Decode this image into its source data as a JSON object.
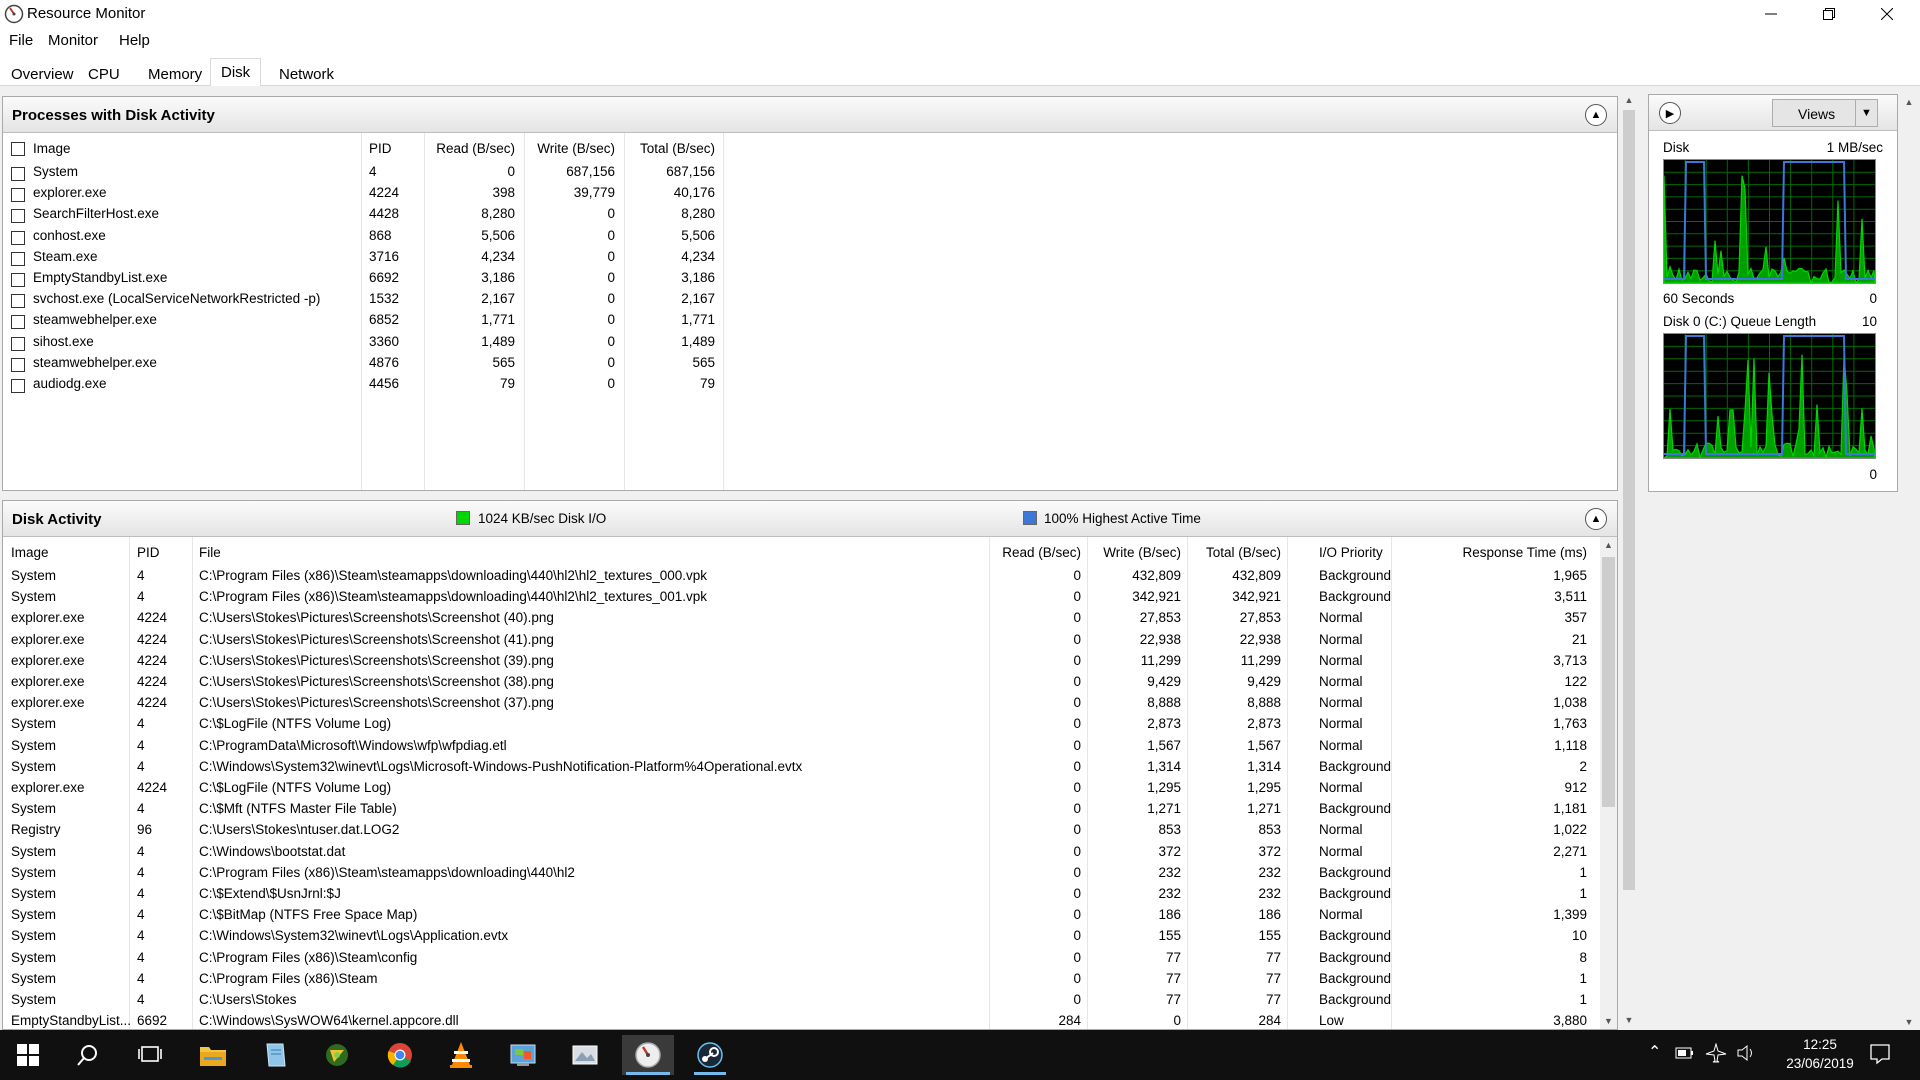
{
  "window": {
    "title": "Resource Monitor",
    "icon": "resource-monitor-icon"
  },
  "menu": [
    "File",
    "Monitor",
    "Help"
  ],
  "tabs": [
    "Overview",
    "CPU",
    "Memory",
    "Disk",
    "Network"
  ],
  "active_tab": "Disk",
  "processes": {
    "title": "Processes with Disk Activity",
    "headers": [
      "Image",
      "PID",
      "Read (B/sec)",
      "Write (B/sec)",
      "Total (B/sec)"
    ],
    "rows": [
      [
        "System",
        "4",
        "0",
        "687,156",
        "687,156"
      ],
      [
        "explorer.exe",
        "4224",
        "398",
        "39,779",
        "40,176"
      ],
      [
        "SearchFilterHost.exe",
        "4428",
        "8,280",
        "0",
        "8,280"
      ],
      [
        "conhost.exe",
        "868",
        "5,506",
        "0",
        "5,506"
      ],
      [
        "Steam.exe",
        "3716",
        "4,234",
        "0",
        "4,234"
      ],
      [
        "EmptyStandbyList.exe",
        "6692",
        "3,186",
        "0",
        "3,186"
      ],
      [
        "svchost.exe (LocalServiceNetworkRestricted -p)",
        "1532",
        "2,167",
        "0",
        "2,167"
      ],
      [
        "steamwebhelper.exe",
        "6852",
        "1,771",
        "0",
        "1,771"
      ],
      [
        "sihost.exe",
        "3360",
        "1,489",
        "0",
        "1,489"
      ],
      [
        "steamwebhelper.exe",
        "4876",
        "565",
        "0",
        "565"
      ],
      [
        "audiodg.exe",
        "4456",
        "79",
        "0",
        "79"
      ]
    ]
  },
  "disk_activity": {
    "title": "Disk Activity",
    "legend_io": "1024 KB/sec Disk I/O",
    "legend_active": "100% Highest Active Time",
    "headers": [
      "Image",
      "PID",
      "File",
      "Read (B/sec)",
      "Write (B/sec)",
      "Total (B/sec)",
      "I/O Priority",
      "Response Time (ms)"
    ],
    "rows": [
      [
        "System",
        "4",
        "C:\\Program Files (x86)\\Steam\\steamapps\\downloading\\440\\hl2\\hl2_textures_000.vpk",
        "0",
        "432,809",
        "432,809",
        "Background",
        "1,965"
      ],
      [
        "System",
        "4",
        "C:\\Program Files (x86)\\Steam\\steamapps\\downloading\\440\\hl2\\hl2_textures_001.vpk",
        "0",
        "342,921",
        "342,921",
        "Background",
        "3,511"
      ],
      [
        "explorer.exe",
        "4224",
        "C:\\Users\\Stokes\\Pictures\\Screenshots\\Screenshot (40).png",
        "0",
        "27,853",
        "27,853",
        "Normal",
        "357"
      ],
      [
        "explorer.exe",
        "4224",
        "C:\\Users\\Stokes\\Pictures\\Screenshots\\Screenshot (41).png",
        "0",
        "22,938",
        "22,938",
        "Normal",
        "21"
      ],
      [
        "explorer.exe",
        "4224",
        "C:\\Users\\Stokes\\Pictures\\Screenshots\\Screenshot (39).png",
        "0",
        "11,299",
        "11,299",
        "Normal",
        "3,713"
      ],
      [
        "explorer.exe",
        "4224",
        "C:\\Users\\Stokes\\Pictures\\Screenshots\\Screenshot (38).png",
        "0",
        "9,429",
        "9,429",
        "Normal",
        "122"
      ],
      [
        "explorer.exe",
        "4224",
        "C:\\Users\\Stokes\\Pictures\\Screenshots\\Screenshot (37).png",
        "0",
        "8,888",
        "8,888",
        "Normal",
        "1,038"
      ],
      [
        "System",
        "4",
        "C:\\$LogFile (NTFS Volume Log)",
        "0",
        "2,873",
        "2,873",
        "Normal",
        "1,763"
      ],
      [
        "System",
        "4",
        "C:\\ProgramData\\Microsoft\\Windows\\wfp\\wfpdiag.etl",
        "0",
        "1,567",
        "1,567",
        "Normal",
        "1,118"
      ],
      [
        "System",
        "4",
        "C:\\Windows\\System32\\winevt\\Logs\\Microsoft-Windows-PushNotification-Platform%4Operational.evtx",
        "0",
        "1,314",
        "1,314",
        "Background",
        "2"
      ],
      [
        "explorer.exe",
        "4224",
        "C:\\$LogFile (NTFS Volume Log)",
        "0",
        "1,295",
        "1,295",
        "Normal",
        "912"
      ],
      [
        "System",
        "4",
        "C:\\$Mft (NTFS Master File Table)",
        "0",
        "1,271",
        "1,271",
        "Background",
        "1,181"
      ],
      [
        "Registry",
        "96",
        "C:\\Users\\Stokes\\ntuser.dat.LOG2",
        "0",
        "853",
        "853",
        "Normal",
        "1,022"
      ],
      [
        "System",
        "4",
        "C:\\Windows\\bootstat.dat",
        "0",
        "372",
        "372",
        "Normal",
        "2,271"
      ],
      [
        "System",
        "4",
        "C:\\Program Files (x86)\\Steam\\steamapps\\downloading\\440\\hl2",
        "0",
        "232",
        "232",
        "Background",
        "1"
      ],
      [
        "System",
        "4",
        "C:\\$Extend\\$UsnJrnl:$J",
        "0",
        "232",
        "232",
        "Background",
        "1"
      ],
      [
        "System",
        "4",
        "C:\\$BitMap (NTFS Free Space Map)",
        "0",
        "186",
        "186",
        "Normal",
        "1,399"
      ],
      [
        "System",
        "4",
        "C:\\Windows\\System32\\winevt\\Logs\\Application.evtx",
        "0",
        "155",
        "155",
        "Background",
        "10"
      ],
      [
        "System",
        "4",
        "C:\\Program Files (x86)\\Steam\\config",
        "0",
        "77",
        "77",
        "Background",
        "8"
      ],
      [
        "System",
        "4",
        "C:\\Program Files (x86)\\Steam",
        "0",
        "77",
        "77",
        "Background",
        "1"
      ],
      [
        "System",
        "4",
        "C:\\Users\\Stokes",
        "0",
        "77",
        "77",
        "Background",
        "1"
      ],
      [
        "EmptyStandbyList...",
        "6692",
        "C:\\Windows\\SysWOW64\\kernel.appcore.dll",
        "284",
        "0",
        "284",
        "Low",
        "3,880"
      ]
    ]
  },
  "side": {
    "views_label": "Views",
    "disk_graph": {
      "label": "Disk",
      "scale": "1 MB/sec",
      "time": "60 Seconds",
      "min": "0"
    },
    "queue_graph": {
      "label": "Disk 0 (C:) Queue Length",
      "scale": "10",
      "min": "0"
    }
  },
  "colors": {
    "io_green": "#00d600",
    "active_blue": "#3c78d8",
    "graph_bg": "#000000",
    "graph_grid": "#006b00"
  },
  "taskbar": {
    "icons": [
      "windows-start-icon",
      "search-icon",
      "task-view-icon",
      "file-explorer-icon",
      "notepad-icon",
      "media-player-icon",
      "chrome-icon",
      "vlc-icon",
      "control-panel-icon",
      "photos-icon",
      "resource-monitor-icon",
      "steam-icon"
    ],
    "time": "12:25",
    "date": "23/06/2019"
  }
}
